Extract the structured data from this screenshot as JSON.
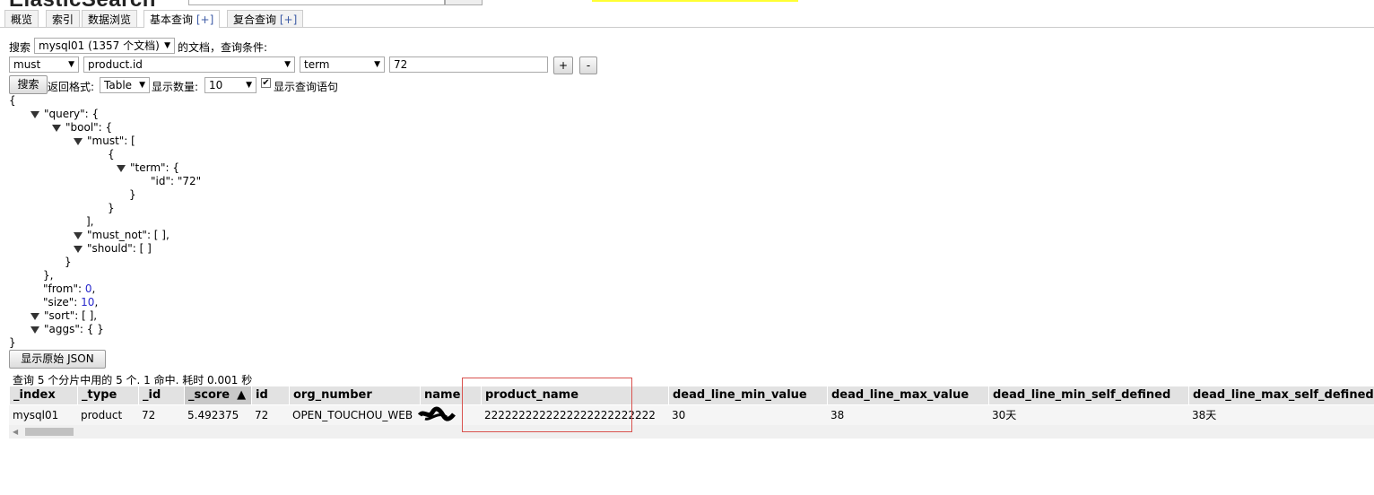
{
  "app": {
    "title": "ElasticSearch"
  },
  "tabs": [
    {
      "label": "概览"
    },
    {
      "label": "索引"
    },
    {
      "label": "数据浏览"
    },
    {
      "label": "基本查询",
      "plus": "[+]"
    },
    {
      "label": "复合查询",
      "plus": "[+]"
    }
  ],
  "search": {
    "label": "搜索",
    "index_select": "mysql01 (1357 个文档)",
    "suffix": "的文档，查询条件:",
    "bool_select": "must",
    "field_select": "product.id",
    "op_select": "term",
    "value": "72",
    "add_label": "+",
    "remove_label": "-",
    "search_button": "搜索",
    "format_label": "返回格式:",
    "format_select": "Table",
    "count_label": "显示数量:",
    "count_select": "10",
    "show_query_label": "显示查询语句",
    "show_query_checked": true
  },
  "query_json": {
    "lines": [
      {
        "text": "{",
        "indent": 0,
        "tri": false
      },
      {
        "text": "\"query\": {",
        "indent": 1,
        "tri": true
      },
      {
        "text": "\"bool\": {",
        "indent": 2,
        "tri": true
      },
      {
        "text": "\"must\": [",
        "indent": 3,
        "tri": true
      },
      {
        "text": "{",
        "indent": 4,
        "tri": false
      },
      {
        "text": "\"term\": {",
        "indent": 5,
        "tri": true
      },
      {
        "text": "\"id\": \"72\"",
        "indent": 6,
        "tri": false
      },
      {
        "text": "}",
        "indent": 5,
        "tri": false
      },
      {
        "text": "}",
        "indent": 4,
        "tri": false
      },
      {
        "text": "],",
        "indent": 3,
        "tri": false
      },
      {
        "text": "\"must_not\": [ ],",
        "indent": 3,
        "tri": true
      },
      {
        "text": "\"should\": [ ]",
        "indent": 3,
        "tri": true
      },
      {
        "text": "}",
        "indent": 2,
        "tri": false
      },
      {
        "text": "},",
        "indent": 1,
        "tri": false
      },
      {
        "text": "\"from\": ",
        "num": "0",
        "tail": ",",
        "indent": 1,
        "tri": false
      },
      {
        "text": "\"size\": ",
        "num": "10",
        "tail": ",",
        "indent": 1,
        "tri": false
      },
      {
        "text": "\"sort\": [ ],",
        "indent": 1,
        "tri": true
      },
      {
        "text": "\"aggs\": { }",
        "indent": 1,
        "tri": true
      },
      {
        "text": "}",
        "indent": 0,
        "tri": false
      }
    ]
  },
  "raw_json_button": "显示原始 JSON",
  "result_summary": "查询 5 个分片中用的 5 个. 1 命中. 耗时 0.001 秒",
  "results": {
    "sort_indicator": "▲",
    "columns": [
      "_index",
      "_type",
      "_id",
      "_score",
      "id",
      "org_number",
      "name",
      "product_name",
      "dead_line_min_value",
      "dead_line_max_value",
      "dead_line_min_self_defined",
      "dead_line_max_self_defined"
    ],
    "rows": [
      [
        "mysql01",
        "product",
        "72",
        "5.492375",
        "72",
        "OPEN_TOUCHOU_WEB",
        "",
        "2222222222222222222222222",
        "30",
        "38",
        "30天",
        "38天"
      ]
    ]
  },
  "colors": {
    "highlight_box": "#d9534f",
    "number": "#2929cc",
    "tab_plus": "#3b5aa5"
  }
}
